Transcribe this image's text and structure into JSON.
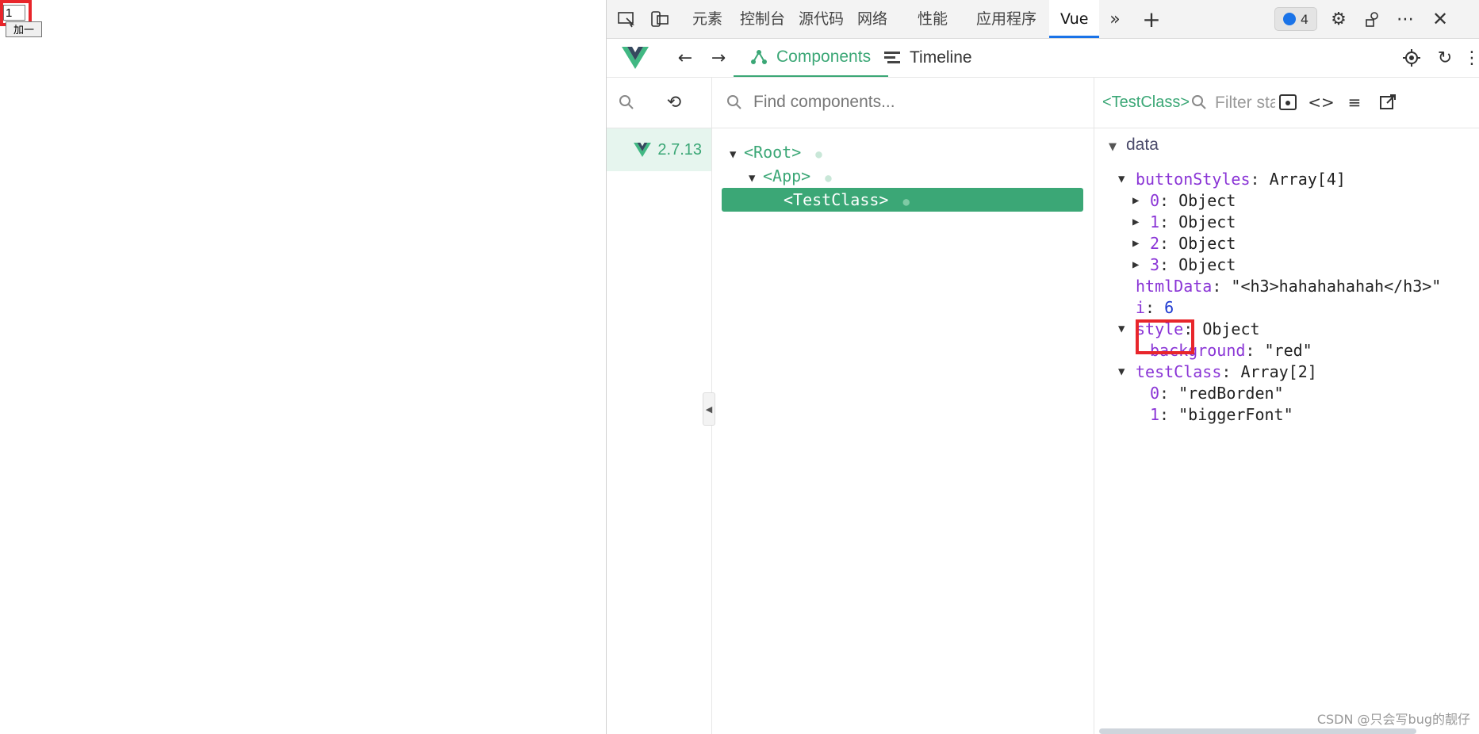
{
  "page": {
    "input_value": "1",
    "button_label": "加一"
  },
  "devtools": {
    "tabs": [
      "元素",
      "控制台",
      "源代码",
      "网络",
      "性能",
      "应用程序",
      "Vue"
    ],
    "active_tab": "Vue",
    "issues_count": "4",
    "vue_tabs": {
      "components": "Components",
      "timeline": "Timeline"
    },
    "vue_version": "2.7.13",
    "find_placeholder": "Find components...",
    "tree": {
      "root": "<Root>",
      "app": "<App>",
      "test_class": "<TestClass>"
    },
    "inspector": {
      "component_name": "<TestClass>",
      "filter_placeholder": "Filter state...",
      "section": "data",
      "button_styles": {
        "key": "buttonStyles",
        "value": "Array[4]"
      },
      "button_style_items": [
        {
          "key": "0",
          "value": "Object"
        },
        {
          "key": "1",
          "value": "Object"
        },
        {
          "key": "2",
          "value": "Object"
        },
        {
          "key": "3",
          "value": "Object"
        }
      ],
      "html_data": {
        "key": "htmlData",
        "value": "\"<h3>hahahahahah</h3>\""
      },
      "i": {
        "key": "i",
        "value": "6"
      },
      "style": {
        "key": "style",
        "value": "Object"
      },
      "style_background": {
        "key": "background",
        "value": "\"red\""
      },
      "test_class": {
        "key": "testClass",
        "value": "Array[2]"
      },
      "test_class_items": [
        {
          "key": "0",
          "value": "\"redBorden\""
        },
        {
          "key": "1",
          "value": "\"biggerFont\""
        }
      ]
    },
    "watermark": "CSDN @只会写bug的靓仔"
  },
  "colors": {
    "vue_green": "#3ba776",
    "highlight_red": "#e8262b",
    "key_purple": "#8a35d6",
    "number_blue": "#1e3ad1"
  }
}
